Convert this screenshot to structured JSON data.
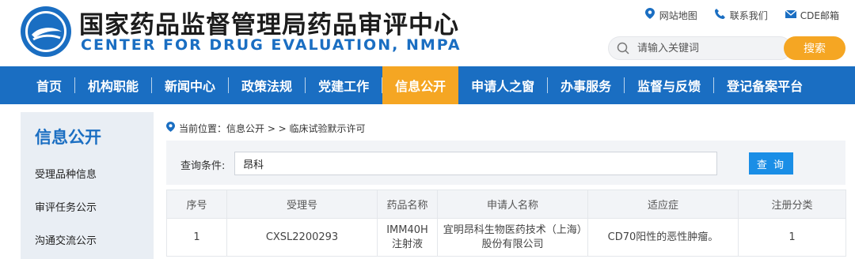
{
  "header": {
    "title_cn": "国家药品监督管理局药品审评中心",
    "title_en": "CENTER FOR DRUG EVALUATION, NMPA",
    "links": [
      {
        "label": "网站地图",
        "icon": "location-pin-icon"
      },
      {
        "label": "联系我们",
        "icon": "phone-icon"
      },
      {
        "label": "CDE邮箱",
        "icon": "mail-icon"
      }
    ],
    "search": {
      "placeholder": "请输入关键词",
      "button": "搜索"
    }
  },
  "nav": {
    "items": [
      "首页",
      "机构职能",
      "新闻中心",
      "政策法规",
      "党建工作",
      "信息公开",
      "申请人之窗",
      "办事服务",
      "监督与反馈",
      "登记备案平台"
    ],
    "active": "信息公开"
  },
  "sidebar": {
    "title": "信息公开",
    "items": [
      "受理品种信息",
      "审评任务公示",
      "沟通交流公示"
    ]
  },
  "breadcrumb": "当前位置：信息公开 > > 临床试验默示许可",
  "query": {
    "label": "查询条件:",
    "value": "昂科",
    "button": "查 询"
  },
  "table": {
    "headers": [
      "序号",
      "受理号",
      "药品名称",
      "申请人名称",
      "适应症",
      "注册分类"
    ],
    "rows": [
      [
        "1",
        "CXSL2200293",
        "IMM40H注射液",
        "宜明昂科生物医药技术（上海）股份有限公司",
        "CD70阳性的恶性肿瘤。",
        "1"
      ]
    ]
  },
  "colors": {
    "brand_blue": "#1a6ec2",
    "active_orange": "#f5a623",
    "query_button": "#1a8ee6"
  }
}
